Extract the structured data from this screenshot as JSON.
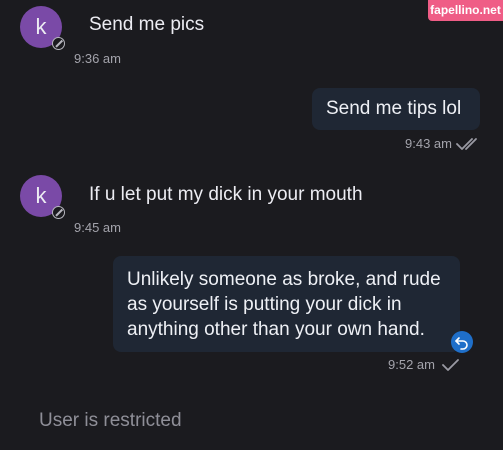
{
  "watermark": {
    "text": "fapellino.net"
  },
  "messages": [
    {
      "direction": "incoming",
      "avatar_letter": "k",
      "text": "Send me pics",
      "time": "9:36 am"
    },
    {
      "direction": "outgoing",
      "text": "Send me tips lol",
      "time": "9:43 am",
      "status_icon": "double-check-icon"
    },
    {
      "direction": "incoming",
      "avatar_letter": "k",
      "text": "If u let put my dick in your mouth",
      "time": "9:45 am"
    },
    {
      "direction": "outgoing",
      "lines": [
        "Unlikely someone as broke, and rude",
        "as yourself is putting your dick in",
        "anything other than your own hand."
      ],
      "time": "9:52 am",
      "status_icon": "check-icon",
      "action_icon": "reply-icon"
    }
  ],
  "footer": {
    "status_text": "User is restricted"
  },
  "colors": {
    "background": "#1b1b1f",
    "outgoing_bubble": "#1f2734",
    "avatar": "#7a4aa7",
    "accent": "#1f6fc9",
    "watermark": "#ef5d86"
  }
}
